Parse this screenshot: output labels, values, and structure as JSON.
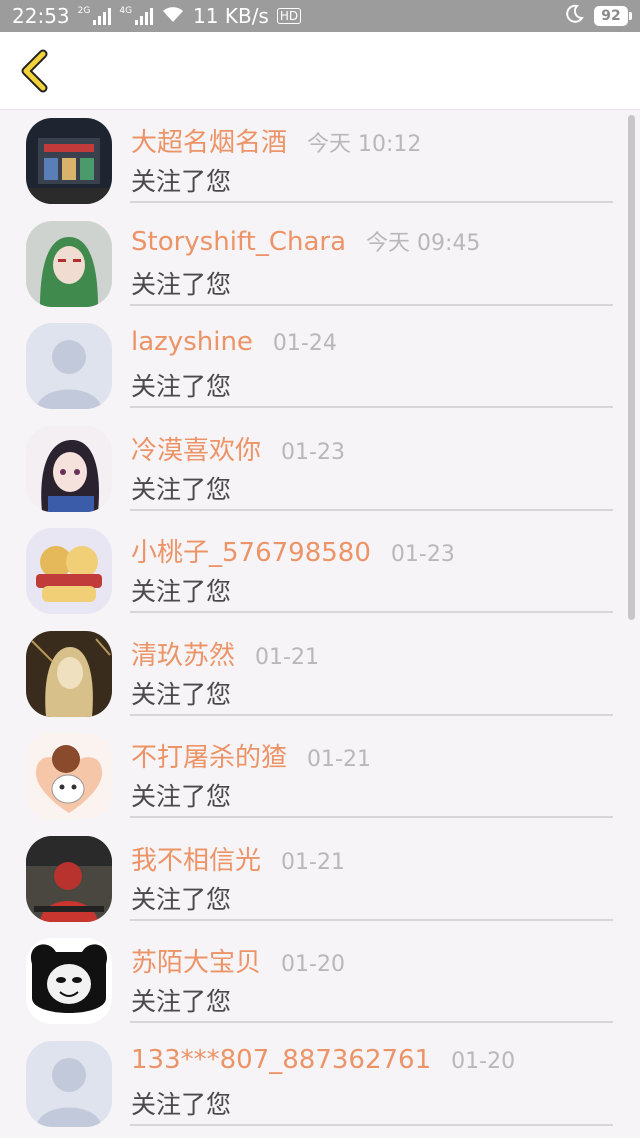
{
  "status_bar": {
    "time": "22:53",
    "net_1": "2G",
    "net_2": "4G",
    "speed": "11 KB/s",
    "hd": "HD",
    "battery": "92"
  },
  "header": {
    "back_icon": "chevron-left-icon",
    "accent": "#f2d43a"
  },
  "list": [
    {
      "name": "大超名烟名酒",
      "time": "今天 10:12",
      "action": "关注了您",
      "avatar": "photo-shop"
    },
    {
      "name": "Storyshift_Chara",
      "time": "今天 09:45",
      "action": "关注了您",
      "avatar": "photo-hood"
    },
    {
      "name": "lazyshine",
      "time": "01-24",
      "action": "关注了您",
      "avatar": "default"
    },
    {
      "name": "冷漠喜欢你",
      "time": "01-23",
      "action": "关注了您",
      "avatar": "photo-anime-girl"
    },
    {
      "name": "小桃子_576798580",
      "time": "01-23",
      "action": "关注了您",
      "avatar": "photo-plush"
    },
    {
      "name": "清玖苏然",
      "time": "01-21",
      "action": "关注了您",
      "avatar": "photo-sepia"
    },
    {
      "name": "不打屠杀的猹",
      "time": "01-21",
      "action": "关注了您",
      "avatar": "photo-cartoon"
    },
    {
      "name": "我不相信光",
      "time": "01-21",
      "action": "关注了您",
      "avatar": "photo-red"
    },
    {
      "name": "苏陌大宝贝",
      "time": "01-20",
      "action": "关注了您",
      "avatar": "photo-panda"
    },
    {
      "name": "133***807_887362761",
      "time": "01-20",
      "action": "关注了您",
      "avatar": "default"
    }
  ],
  "colors": {
    "name": "#ec9467",
    "time": "#b8b8b8",
    "action": "#4a4a4a"
  }
}
